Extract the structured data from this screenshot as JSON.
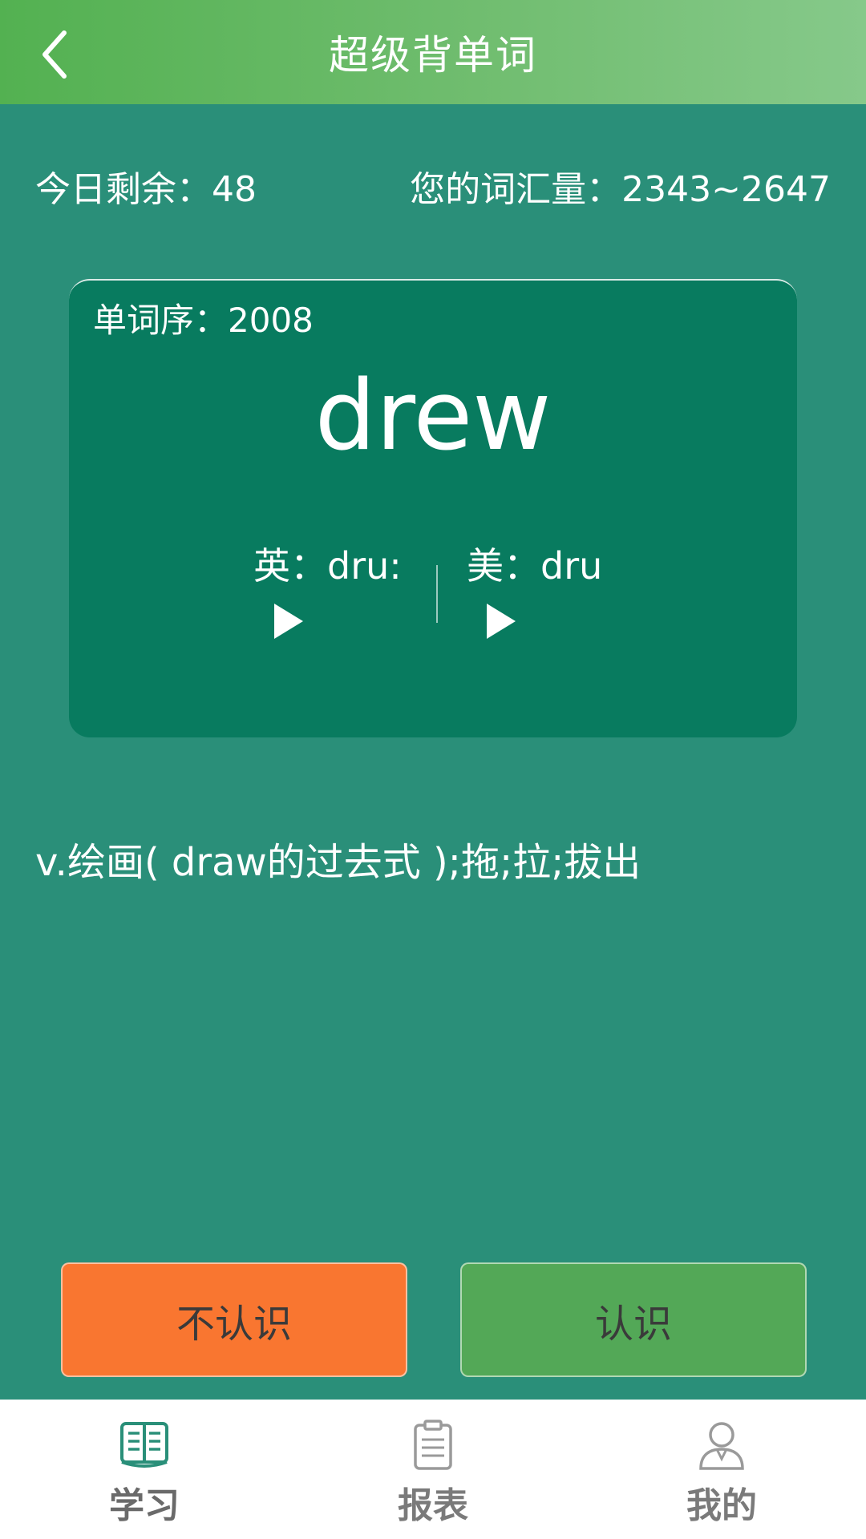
{
  "header": {
    "title": "超级背单词"
  },
  "stats": {
    "remaining_today": "今日剩余：48",
    "vocab_size": "您的词汇量：2343~2647"
  },
  "card": {
    "sequence": "单词序：2008",
    "word": "drew",
    "pron_uk": "英：dru:",
    "pron_us": "美：dru"
  },
  "definition": "v.绘画( draw的过去式 );拖;拉;拔出",
  "actions": {
    "unknown_label": "不认识",
    "known_label": "认识"
  },
  "nav": {
    "items": [
      {
        "label": "学习",
        "icon": "book-icon",
        "active": true
      },
      {
        "label": "报表",
        "icon": "clipboard-icon",
        "active": false
      },
      {
        "label": "我的",
        "icon": "user-icon",
        "active": false
      }
    ]
  },
  "colors": {
    "background": "#2a8f79",
    "card": "#087b5f",
    "unknown_button": "#f97630",
    "known_button": "#53a857",
    "header_start": "#53b151",
    "header_end": "#86c98a",
    "nav_active_icon": "#2a8f79"
  }
}
